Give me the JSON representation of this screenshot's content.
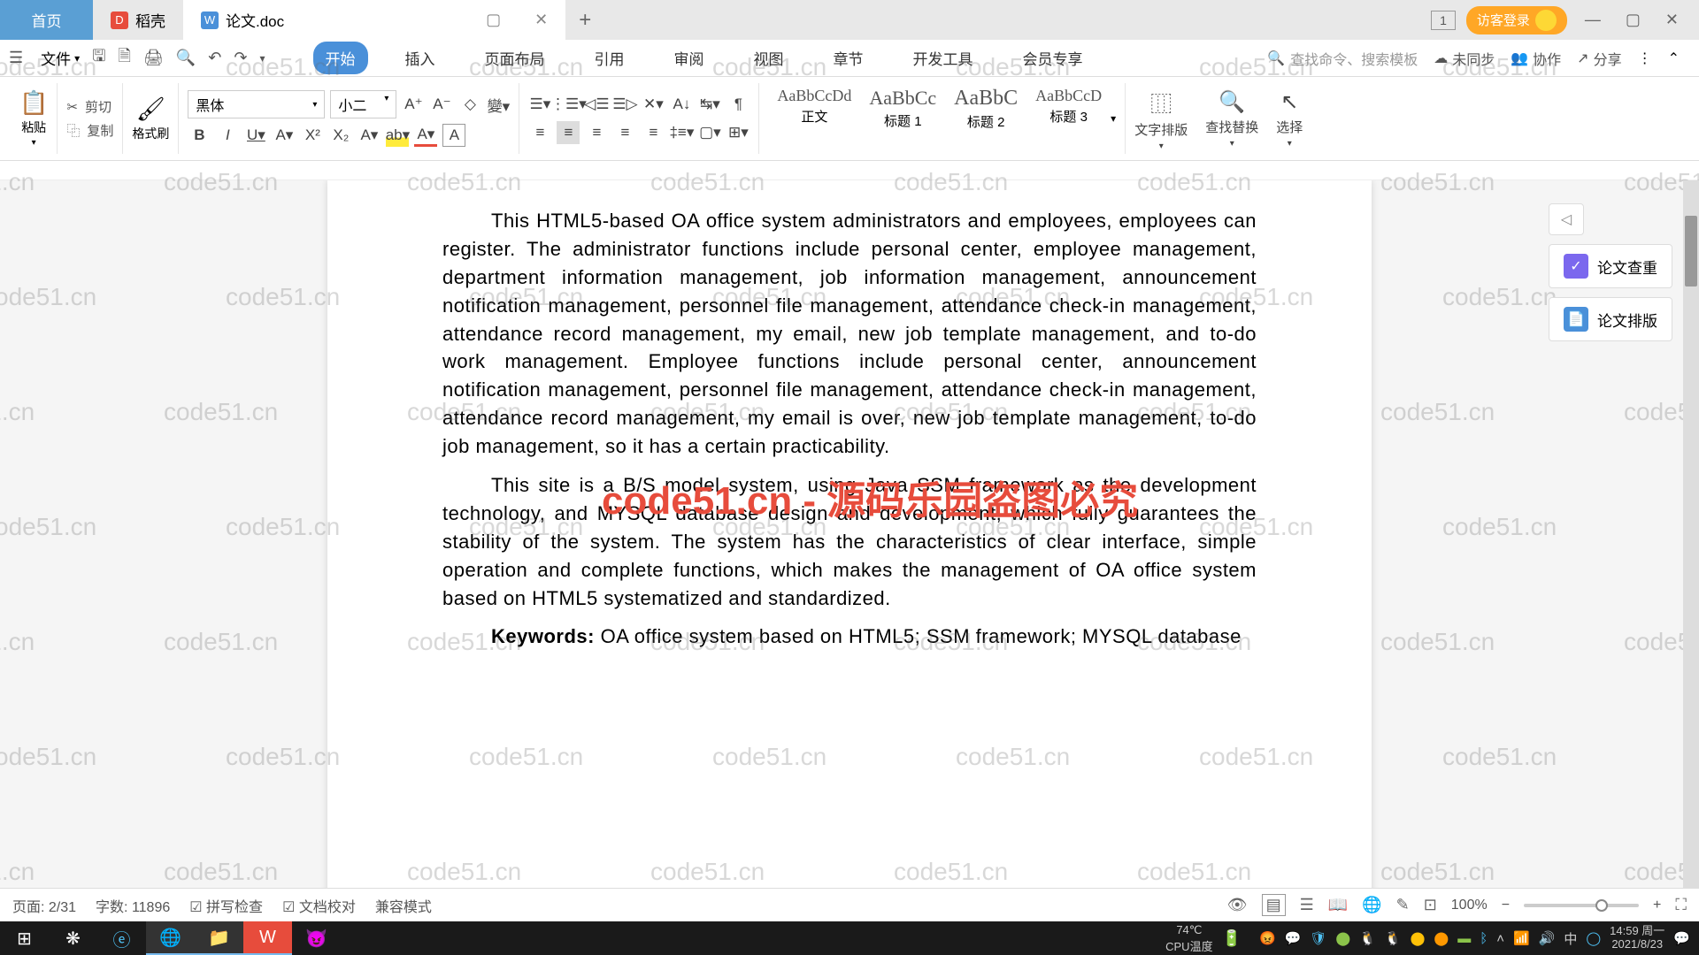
{
  "tabs": {
    "home": "首页",
    "doke": "稻壳",
    "doc": "论文.doc"
  },
  "title_right": {
    "count": "1",
    "login": "访客登录"
  },
  "menu": {
    "file": "文件",
    "items": [
      "开始",
      "插入",
      "页面布局",
      "引用",
      "审阅",
      "视图",
      "章节",
      "开发工具",
      "会员专享"
    ],
    "search_ph": "查找命令、搜索模板",
    "unsync": "未同步",
    "coop": "协作",
    "share": "分享"
  },
  "ribbon": {
    "paste": "粘贴",
    "cut": "剪切",
    "copy": "复制",
    "brush": "格式刷",
    "font": "黑体",
    "size": "小二",
    "styles": [
      {
        "preview": "AaBbCcDd",
        "label": "正文"
      },
      {
        "preview": "AaBbCc",
        "label": "标题 1"
      },
      {
        "preview": "AaBbC",
        "label": "标题 2"
      },
      {
        "preview": "AaBbCcD",
        "label": "标题 3"
      }
    ],
    "text_layout": "文字排版",
    "find": "查找替换",
    "select": "选择"
  },
  "document": {
    "p1": "This HTML5-based OA office system administrators and employees, employees can register. The administrator functions include personal center, employee management, department information management, job information management, announcement notification management, personnel file management, attendance check-in management, attendance record management, my email, new job template management, and to-do work management. Employee functions include personal center, announcement notification management, personnel file management, attendance check-in management, attendance record management, my email is over, new job template management, to-do job management, so it has a certain practicability.",
    "p2": "This site is a B/S model system, using Java SSM framework as the development technology, and MYSQL database design and development, which fully guarantees the stability of the system. The system has the characteristics of clear interface, simple operation and complete functions, which makes the management of OA office system based on HTML5 systematized and standardized.",
    "kw_label": "Keywords:",
    "kw_text": " OA office system based on HTML5; SSM framework; MYSQL database"
  },
  "side": {
    "check": "论文查重",
    "layout": "论文排版"
  },
  "status": {
    "page": "页面: 2/31",
    "words": "字数: 11896",
    "spell": "拼写检查",
    "proof": "文档校对",
    "compat": "兼容模式",
    "zoom": "100%"
  },
  "taskbar": {
    "cpu_label": "CPU温度",
    "temp": "74℃",
    "time": "14:59 周一",
    "date": "2021/8/23",
    "ime": "中"
  },
  "watermark": "code51.cn",
  "watermark_red": "code51.cn - 源码乐园盗图必究"
}
